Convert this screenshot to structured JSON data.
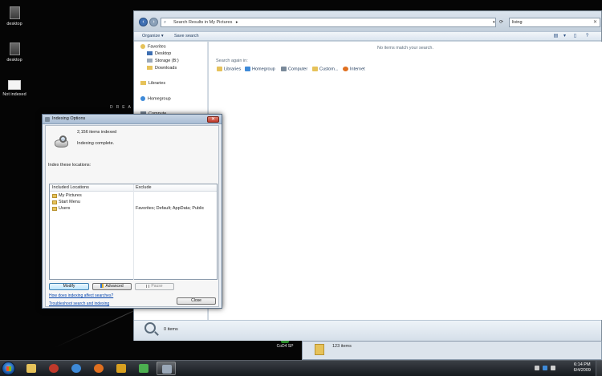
{
  "desktop": {
    "icons": [
      {
        "label": "desktop"
      },
      {
        "label": "desktop"
      },
      {
        "label": "Not indexed"
      }
    ],
    "wallpaper_text": "DREA",
    "shortcut_label": "CoD4 SP"
  },
  "explorer": {
    "address": "Search Results in My Pictures",
    "address_sep": "▸",
    "search_value": "living",
    "search_clear": "✕",
    "toolbar": {
      "organize": "Organize",
      "organize_caret": "▾",
      "save_search": "Save search"
    },
    "nav": {
      "favorites": "Favorites",
      "items": [
        "Desktop",
        "Storage (B:)",
        "Downloads"
      ],
      "libraries": "Libraries",
      "homegroup": "Homegroup",
      "computer_partial": "Compute"
    },
    "no_items": "No items match your search.",
    "search_again_label": "Search again in:",
    "search_again": [
      {
        "label": "Libraries",
        "color": "#e6c25a"
      },
      {
        "label": "Homegroup",
        "color": "#3e8ad8"
      },
      {
        "label": "Computer",
        "color": "#7a8a9a"
      },
      {
        "label": "Custom...",
        "color": "#e6c25a"
      },
      {
        "label": "Internet",
        "color": "#e07020"
      }
    ],
    "status": "0 items"
  },
  "explorer2": {
    "status": "123 items"
  },
  "dialog": {
    "title": "Indexing Options",
    "close": "✕",
    "items_indexed": "2,156 items indexed",
    "status": "Indexing complete.",
    "index_locations_label": "Index these locations:",
    "columns": {
      "included": "Included Locations",
      "exclude": "Exclude"
    },
    "locations": [
      {
        "name": "My Pictures",
        "exclude": ""
      },
      {
        "name": "Start Menu",
        "exclude": ""
      },
      {
        "name": "Users",
        "exclude": "Favorites; Default; AppData; Public"
      }
    ],
    "buttons": {
      "modify": "Modify",
      "advanced": "Advanced",
      "pause": "Pause",
      "close": "Close"
    },
    "links": {
      "how": "How does indexing affect searches?",
      "troubleshoot": "Troubleshoot search and indexing"
    }
  },
  "taskbar": {
    "apps": [
      {
        "name": "explorer",
        "color": "#e6c25a"
      },
      {
        "name": "spyware-app",
        "color": "#c0392b"
      },
      {
        "name": "internet-explorer",
        "color": "#3e8ad8"
      },
      {
        "name": "firefox",
        "color": "#e07020"
      },
      {
        "name": "media-player",
        "color": "#d8a020"
      },
      {
        "name": "network-app",
        "color": "#4caf50"
      },
      {
        "name": "indexing-options",
        "color": "#9aa8b8"
      }
    ],
    "time": "6:14 PM",
    "date": "6/4/2009"
  }
}
